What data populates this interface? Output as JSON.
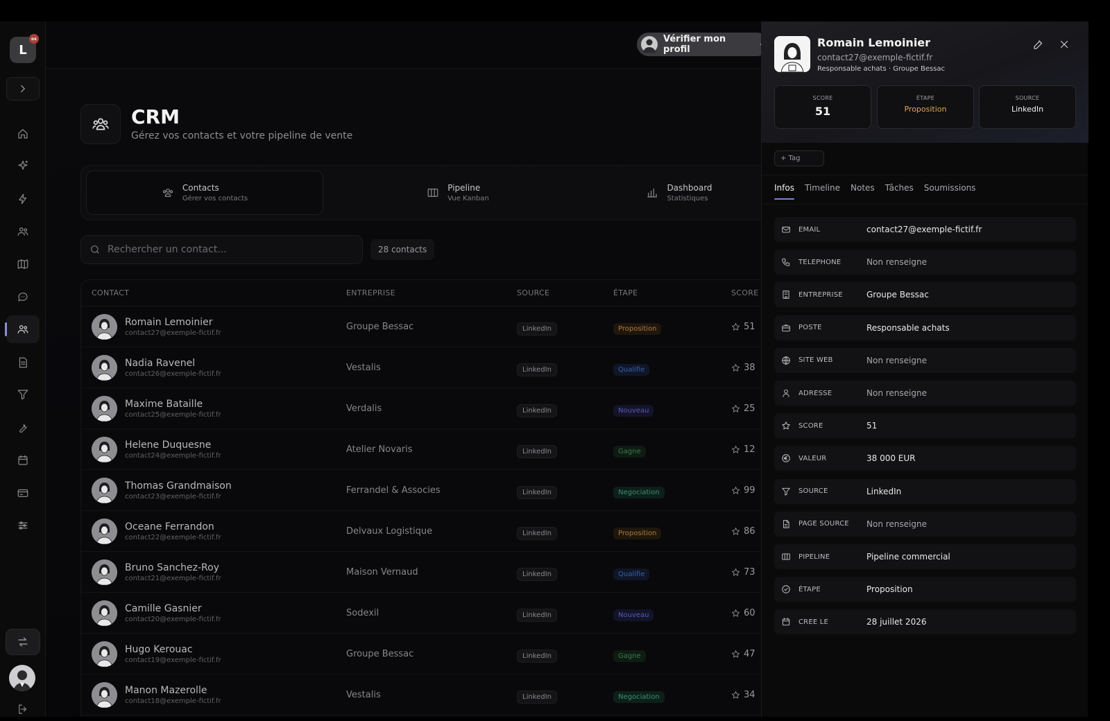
{
  "sidebar": {
    "logo_letter": "L",
    "logo_badge": "ox",
    "nav": [
      "home-icon",
      "sparkles-icon",
      "bolt-icon",
      "users-icon",
      "map-icon",
      "chat-icon",
      "contacts-icon",
      "document-icon",
      "filter-icon",
      "wrench-icon",
      "calendar-icon",
      "card-icon",
      "sliders-icon"
    ],
    "active_nav": "contacts-icon"
  },
  "header": {
    "verify_label": "Vérifier mon profil"
  },
  "page": {
    "title": "CRM",
    "subtitle": "Gérez vos contacts et votre pipeline de vente"
  },
  "tabs": [
    {
      "label": "Contacts",
      "sub": "Gérer vos contacts",
      "icon": "users-icon",
      "active": true
    },
    {
      "label": "Pipeline",
      "sub": "Vue Kanban",
      "icon": "columns-icon",
      "active": false
    },
    {
      "label": "Dashboard",
      "sub": "Statistiques",
      "icon": "bar-chart-icon",
      "active": false
    }
  ],
  "search": {
    "placeholder": "Rechercher un contact..."
  },
  "count_label": "28 contacts",
  "table": {
    "headers": {
      "contact": "CONTACT",
      "entreprise": "ENTREPRISE",
      "source": "SOURCE",
      "etape": "ÉTAPE",
      "score": "SCORE"
    },
    "rows": [
      {
        "name": "Romain Lemoinier",
        "email": "contact27@exemple-fictif.fr",
        "company": "Groupe Bessac",
        "source": "LinkedIn",
        "stage": "Proposition",
        "score": "51"
      },
      {
        "name": "Nadia Ravenel",
        "email": "contact26@exemple-fictif.fr",
        "company": "Vestalis",
        "source": "LinkedIn",
        "stage": "Qualifie",
        "score": "38"
      },
      {
        "name": "Maxime Bataille",
        "email": "contact25@exemple-fictif.fr",
        "company": "Verdalis",
        "source": "LinkedIn",
        "stage": "Nouveau",
        "score": "25"
      },
      {
        "name": "Helene Duquesne",
        "email": "contact24@exemple-fictif.fr",
        "company": "Atelier Novaris",
        "source": "LinkedIn",
        "stage": "Gagne",
        "score": "12"
      },
      {
        "name": "Thomas Grandmaison",
        "email": "contact23@exemple-fictif.fr",
        "company": "Ferrandel & Associes",
        "source": "LinkedIn",
        "stage": "Negociation",
        "score": "99"
      },
      {
        "name": "Oceane Ferrandon",
        "email": "contact22@exemple-fictif.fr",
        "company": "Delvaux Logistique",
        "source": "LinkedIn",
        "stage": "Proposition",
        "score": "86"
      },
      {
        "name": "Bruno Sanchez-Roy",
        "email": "contact21@exemple-fictif.fr",
        "company": "Maison Vernaud",
        "source": "LinkedIn",
        "stage": "Qualifie",
        "score": "73"
      },
      {
        "name": "Camille Gasnier",
        "email": "contact20@exemple-fictif.fr",
        "company": "Sodexil",
        "source": "LinkedIn",
        "stage": "Nouveau",
        "score": "60"
      },
      {
        "name": "Hugo Kerouac",
        "email": "contact19@exemple-fictif.fr",
        "company": "Groupe Bessac",
        "source": "LinkedIn",
        "stage": "Gagne",
        "score": "47"
      },
      {
        "name": "Manon Mazerolle",
        "email": "contact18@exemple-fictif.fr",
        "company": "Vestalis",
        "source": "LinkedIn",
        "stage": "Negociation",
        "score": "34"
      }
    ]
  },
  "stage_colors": {
    "Proposition": {
      "fg": "#b07a3f",
      "bg": "#1f160c"
    },
    "Qualifie": {
      "fg": "#3c5fa8",
      "bg": "#0f1628"
    },
    "Nouveau": {
      "fg": "#5a5cae",
      "bg": "#13132a"
    },
    "Gagne": {
      "fg": "#3d7a4f",
      "bg": "#0e1c12"
    },
    "Negociation": {
      "fg": "#3f8f72",
      "bg": "#0d1f19"
    }
  },
  "panel": {
    "name": "Romain Lemoinier",
    "email": "contact27@exemple-fictif.fr",
    "role": "Responsable achats · Groupe Bessac",
    "stats": [
      {
        "label": "SCORE",
        "value": "51",
        "color": "#f4f4f4"
      },
      {
        "label": "ÉTAPE",
        "value": "Proposition",
        "color": "#e0a45a"
      },
      {
        "label": "SOURCE",
        "value": "LinkedIn",
        "color": "#f4f4f4"
      }
    ],
    "tag_label": "+ Tag",
    "tabs": [
      "Infos",
      "Timeline",
      "Notes",
      "Tâches",
      "Soumissions"
    ],
    "active_tab": "Infos",
    "fields": [
      {
        "icon": "mail-icon",
        "label": "EMAIL",
        "value": "contact27@exemple-fictif.fr",
        "muted": false
      },
      {
        "icon": "phone-icon",
        "label": "TELEPHONE",
        "value": "Non renseigne",
        "muted": true
      },
      {
        "icon": "building-icon",
        "label": "ENTREPRISE",
        "value": "Groupe Bessac",
        "muted": false
      },
      {
        "icon": "briefcase-icon",
        "label": "POSTE",
        "value": "Responsable achats",
        "muted": false
      },
      {
        "icon": "globe-icon",
        "label": "SITE WEB",
        "value": "Non renseigne",
        "muted": true
      },
      {
        "icon": "person-icon",
        "label": "ADRESSE",
        "value": "Non renseigne",
        "muted": true
      },
      {
        "icon": "star-icon",
        "label": "SCORE",
        "value": "51",
        "muted": false
      },
      {
        "icon": "euro-icon",
        "label": "VALEUR",
        "value": "38 000 EUR",
        "muted": false
      },
      {
        "icon": "filter-icon",
        "label": "SOURCE",
        "value": "LinkedIn",
        "muted": false
      },
      {
        "icon": "file-icon",
        "label": "PAGE SOURCE",
        "value": "Non renseigne",
        "muted": true
      },
      {
        "icon": "columns-icon",
        "label": "PIPELINE",
        "value": "Pipeline commercial",
        "muted": false
      },
      {
        "icon": "check-circle-icon",
        "label": "ÉTAPE",
        "value": "Proposition",
        "muted": false
      },
      {
        "icon": "calendar-icon",
        "label": "CREE LE",
        "value": "28 juillet 2026",
        "muted": false
      }
    ]
  }
}
